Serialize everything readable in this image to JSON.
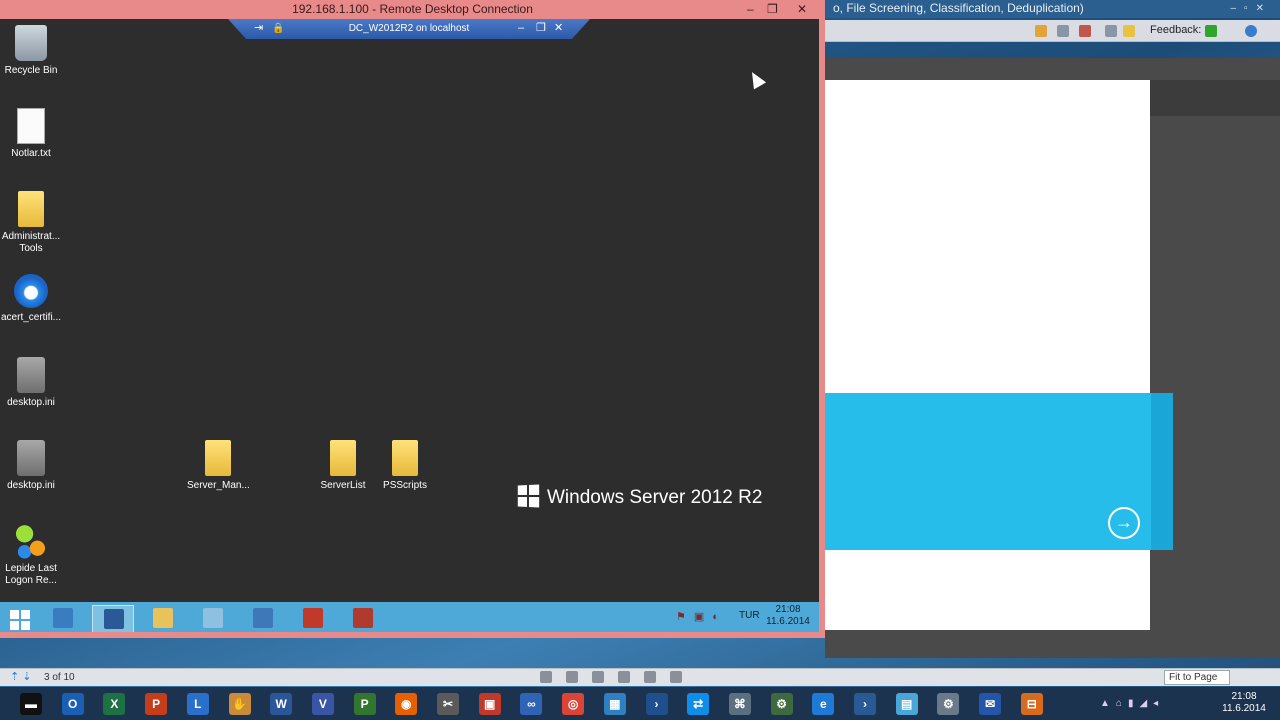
{
  "host": {
    "title": "o, File Screening, Classification, Deduplication)",
    "toolbar": {
      "feedback_label": "Feedback:"
    },
    "status": {
      "page_counter": "3 of 10",
      "zoom_mode": "Fit to Page"
    },
    "clock": {
      "time": "21:08",
      "date": "11.6.2014"
    },
    "taskbar": {
      "items": [
        {
          "name": "cmd",
          "glyph": "▬",
          "color": "#111111"
        },
        {
          "name": "outlook",
          "glyph": "O",
          "color": "#1a5fb4"
        },
        {
          "name": "excel",
          "glyph": "X",
          "color": "#1e7145"
        },
        {
          "name": "powerpoint",
          "glyph": "P",
          "color": "#c43e1c"
        },
        {
          "name": "lync",
          "glyph": "L",
          "color": "#2a6fc9"
        },
        {
          "name": "hand-tool",
          "glyph": "✋",
          "color": "#c98a3a"
        },
        {
          "name": "word",
          "glyph": "W",
          "color": "#2b579a"
        },
        {
          "name": "visio",
          "glyph": "V",
          "color": "#3955a3"
        },
        {
          "name": "project",
          "glyph": "P",
          "color": "#31752f"
        },
        {
          "name": "firefox",
          "glyph": "◉",
          "color": "#e66000"
        },
        {
          "name": "snipping",
          "glyph": "✂",
          "color": "#5a5a5a"
        },
        {
          "name": "toolbox",
          "glyph": "▣",
          "color": "#c0392b"
        },
        {
          "name": "infinity",
          "glyph": "∞",
          "color": "#2f63b5"
        },
        {
          "name": "chrome",
          "glyph": "◎",
          "color": "#db4437"
        },
        {
          "name": "calculator",
          "glyph": "▦",
          "color": "#2f80c0"
        },
        {
          "name": "powershell",
          "glyph": "›",
          "color": "#1f4f8c"
        },
        {
          "name": "teamviewer",
          "glyph": "⇄",
          "color": "#0e8ee9"
        },
        {
          "name": "network",
          "glyph": "⌘",
          "color": "#5b6f80"
        },
        {
          "name": "admin-tools",
          "glyph": "⚙",
          "color": "#3f6a3f"
        },
        {
          "name": "ie",
          "glyph": "e",
          "color": "#1f7ad6"
        },
        {
          "name": "powershell-2",
          "glyph": "›",
          "color": "#2a5a96"
        },
        {
          "name": "explorer-2",
          "glyph": "▤",
          "color": "#4aa6d6"
        },
        {
          "name": "settings",
          "glyph": "⚙",
          "color": "#6a7a8a"
        },
        {
          "name": "outlook-2",
          "glyph": "✉",
          "color": "#2356a8"
        },
        {
          "name": "slides",
          "glyph": "⊟",
          "color": "#d86a1c"
        }
      ]
    }
  },
  "rdp": {
    "window_title": "192.168.1.100 - Remote Desktop Connection",
    "connection_bar": {
      "label": "DC_W2012R2 on localhost"
    },
    "desktop_icons": [
      {
        "label": "Recycle Bin",
        "type": "bin"
      },
      {
        "label": "Notlar.txt",
        "type": "file"
      },
      {
        "label": "Administrat... Tools",
        "type": "folder"
      },
      {
        "label": "acert_certifi...",
        "type": "ie"
      },
      {
        "label": "desktop.ini",
        "type": "ini"
      },
      {
        "label": "desktop.ini",
        "type": "ini"
      },
      {
        "label": "Lepide Last Logon Re...",
        "type": "lepide"
      },
      {
        "label": "Server_Man...",
        "type": "folder"
      },
      {
        "label": "ServerList",
        "type": "folder"
      },
      {
        "label": "PSScripts",
        "type": "folder"
      }
    ],
    "branding": "Windows Server 2012 R2",
    "taskbar": {
      "language": "TUR",
      "clock": {
        "time": "21:08",
        "date": "11.6.2014"
      },
      "items": [
        {
          "name": "server-manager",
          "color": "#3a7cc0"
        },
        {
          "name": "powershell",
          "color": "#2a5a96"
        },
        {
          "name": "file-explorer",
          "color": "#e8c25a"
        },
        {
          "name": "notepad",
          "color": "#8fc0df"
        },
        {
          "name": "powershell-ise",
          "color": "#3e78b8"
        },
        {
          "name": "toolbox",
          "color": "#c0392b"
        },
        {
          "name": "tools",
          "color": "#b03a2e"
        }
      ]
    }
  }
}
